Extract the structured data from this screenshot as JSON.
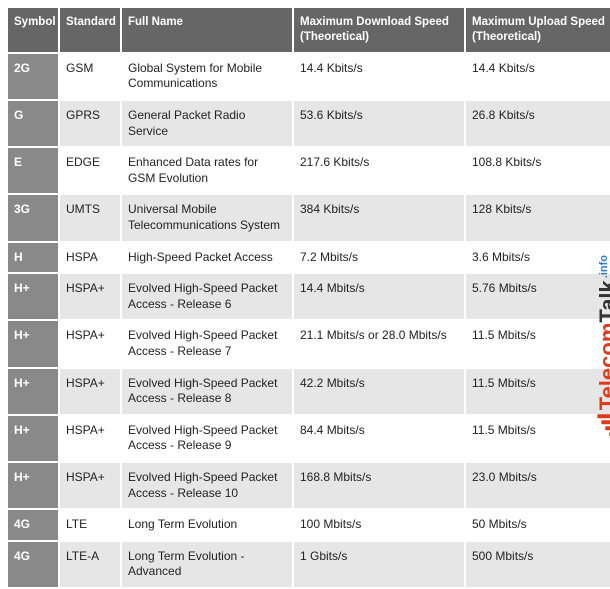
{
  "table": {
    "headers": {
      "symbol": "Symbol",
      "standard": "Standard",
      "full_name": "Full Name",
      "max_down": "Maximum Download Speed (Theoretical)",
      "max_up": "Maximum Upload Speed (Theoretical)"
    },
    "rows": [
      {
        "symbol": "2G",
        "standard": "GSM",
        "full_name": "Global System for Mobile Communications",
        "max_down": "14.4 Kbits/s",
        "max_up": "14.4 Kbits/s"
      },
      {
        "symbol": "G",
        "standard": "GPRS",
        "full_name": "General Packet Radio Service",
        "max_down": "53.6 Kbits/s",
        "max_up": "26.8 Kbits/s"
      },
      {
        "symbol": "E",
        "standard": "EDGE",
        "full_name": "Enhanced Data rates for GSM Evolution",
        "max_down": "217.6 Kbits/s",
        "max_up": "108.8 Kbits/s"
      },
      {
        "symbol": "3G",
        "standard": "UMTS",
        "full_name": "Universal Mobile Telecommunications System",
        "max_down": "384 Kbits/s",
        "max_up": "128 Kbits/s"
      },
      {
        "symbol": "H",
        "standard": "HSPA",
        "full_name": "High-Speed Packet Access",
        "max_down": "7.2 Mbits/s",
        "max_up": "3.6 Mbits/s"
      },
      {
        "symbol": "H+",
        "standard": "HSPA+",
        "full_name": "Evolved High-Speed Packet Access - Release 6",
        "max_down": "14.4 Mbits/s",
        "max_up": "5.76 Mbits/s"
      },
      {
        "symbol": "H+",
        "standard": "HSPA+",
        "full_name": "Evolved High-Speed Packet Access - Release 7",
        "max_down": "21.1 Mbits/s or 28.0 Mbits/s",
        "max_up": "11.5 Mbits/s"
      },
      {
        "symbol": "H+",
        "standard": "HSPA+",
        "full_name": "Evolved High-Speed Packet Access - Release 8",
        "max_down": "42.2 Mbits/s",
        "max_up": "11.5 Mbits/s"
      },
      {
        "symbol": "H+",
        "standard": "HSPA+",
        "full_name": "Evolved High-Speed Packet Access - Release 9",
        "max_down": "84.4 Mbits/s",
        "max_up": "11.5 Mbits/s"
      },
      {
        "symbol": "H+",
        "standard": "HSPA+",
        "full_name": "Evolved High-Speed Packet Access - Release 10",
        "max_down": "168.8 Mbits/s",
        "max_up": "23.0 Mbits/s"
      },
      {
        "symbol": "4G",
        "standard": "LTE",
        "full_name": "Long Term Evolution",
        "max_down": "100 Mbits/s",
        "max_up": "50 Mbits/s"
      },
      {
        "symbol": "4G",
        "standard": "LTE-A",
        "full_name": "Long Term Evolution - Advanced",
        "max_down": "1 Gbits/s",
        "max_up": "500 Mbits/s"
      }
    ]
  },
  "watermark": {
    "brand_left": "Telecom",
    "brand_right": "Talk",
    "suffix": ".info"
  }
}
